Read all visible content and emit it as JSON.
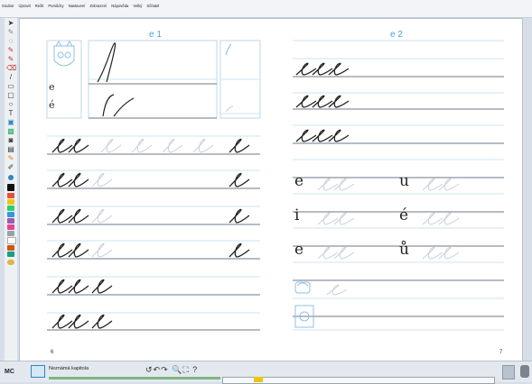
{
  "menu": {
    "items": [
      "Soubor",
      "Úpravit",
      "Režit",
      "Pomůcky",
      "Nastavení",
      "Zobrazení",
      "Nápověda",
      "Velký",
      "Sčítatel"
    ]
  },
  "page_left": {
    "title": "e 1",
    "page_number": "6",
    "sample_labels": [
      "e",
      "é"
    ]
  },
  "page_right": {
    "title": "e 2",
    "page_number": "7",
    "row_labels": [
      "e",
      "u",
      "i",
      "é",
      "e",
      "ů"
    ]
  },
  "status": {
    "mode": "MC",
    "chapter": "Neznámá kapitola",
    "tools": "↺↶↷ 🔍⛶ ?"
  },
  "colors": {
    "accent": "#4aa3d8",
    "ink": "#222222",
    "faint_ink": "#c9cfd6",
    "guide_line": "#cfe3f1"
  }
}
